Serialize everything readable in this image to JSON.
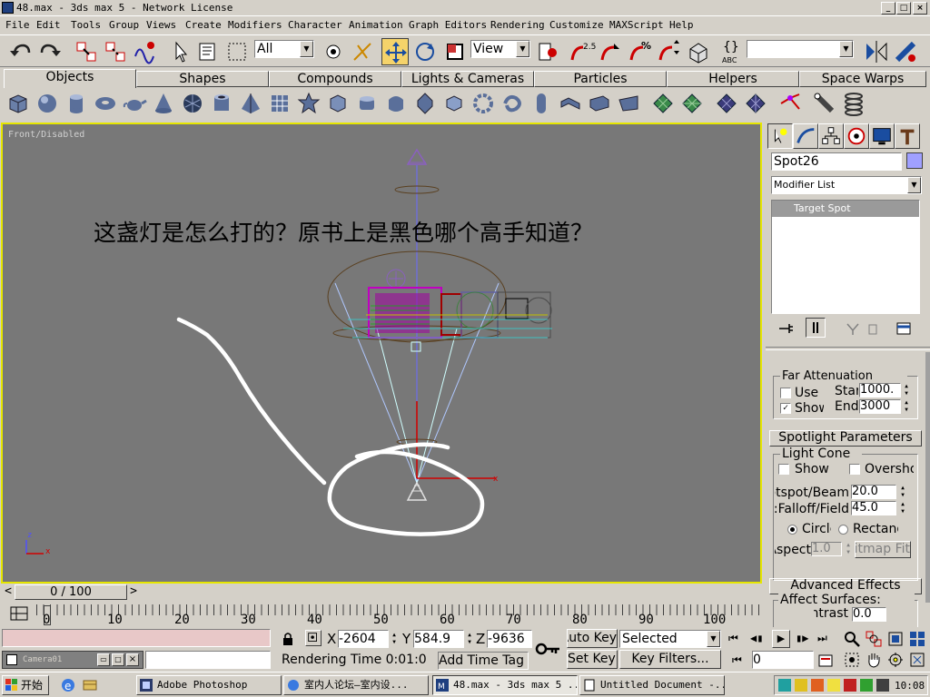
{
  "window": {
    "title": "48.max - 3ds max 5 - Network License",
    "btn_min": "_",
    "btn_max": "□",
    "btn_close": "×"
  },
  "menu": [
    "File",
    "Edit",
    "Tools",
    "Group",
    "Views",
    "Create",
    "Modifiers",
    "Character",
    "Animation",
    "Graph Editors",
    "Rendering",
    "Customize",
    "MAXScript",
    "Help"
  ],
  "toolbar": {
    "selection_filter": "All",
    "ref_coord": "View",
    "angle_snap_label": "2.5",
    "percent_snap_label": "%",
    "named_selection": "",
    "abc_label": "ABC"
  },
  "tabs": [
    "Objects",
    "Shapes",
    "Compounds",
    "Lights & Cameras",
    "Particles",
    "Helpers",
    "Space Warps"
  ],
  "viewport": {
    "label": "Front/Disabled",
    "overlay_text": "这盏灯是怎么打的？原书上是黑色哪个高手知道？",
    "axis_z": "z",
    "axis_x": "x"
  },
  "cmd_panel": {
    "object_name": "Spot26",
    "object_color": "#a0a0ff",
    "modifier_list": "Modifier List",
    "stack_item": "Target Spot",
    "far_atten": {
      "title": "Far Attenuation",
      "use_label": "Use",
      "show_label": "Show",
      "use_checked": "",
      "show_checked": "✓",
      "start_label": "Start",
      "end_label": "End",
      "start_val": "1000.",
      "end_val": "3000"
    },
    "spotlight": {
      "title": "Spotlight Parameters",
      "light_cone": "Light Cone",
      "show_cone": "Show",
      "overshoot": "Overshoot",
      "hotspot_label": "Hotspot/Beam:",
      "hotspot_val": "20.0",
      "falloff_label": "Falloff/Field:",
      "falloff_val": "45.0",
      "circle": "Circle",
      "rectangle": "Rectangle",
      "aspect_label": "Aspect:",
      "aspect_val": "1.0",
      "bitmap_fit": "Bitmap Fit"
    },
    "advanced": {
      "title": "Advanced Effects",
      "affect_surfaces": "Affect Surfaces:",
      "contrast_label": "Contrast:",
      "contrast_val": "0.0"
    }
  },
  "timeline": {
    "frame_slider": "0 / 100",
    "ticks": [
      "0",
      "10",
      "20",
      "30",
      "40",
      "50",
      "60",
      "70",
      "80",
      "90",
      "100"
    ]
  },
  "status": {
    "viewport_name": "Camera01",
    "x_label": "X",
    "x_val": "-2604",
    "y_label": "Y",
    "y_val": "584.9",
    "z_label": "Z",
    "z_val": "-9636",
    "auto_key": "Auto Key",
    "set_key": "Set Key",
    "selected": "Selected",
    "key_filters": "Key Filters...",
    "rendering_time": "Rendering Time  0:01:0",
    "add_time_tag": "Add Time Tag",
    "frame_field": "0"
  },
  "taskbar": {
    "start": "开始",
    "items": [
      "Adobe Photoshop",
      "室内人论坛—室内设...",
      "48.max - 3ds max 5 ...",
      "Untitled Document -..."
    ],
    "clock": "10:08"
  }
}
